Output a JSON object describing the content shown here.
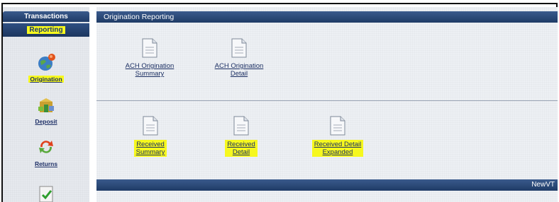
{
  "sidebar": {
    "tabs": [
      "Transactions",
      "Reporting"
    ],
    "items": [
      {
        "label": "Origination"
      },
      {
        "label": "Deposit"
      },
      {
        "label": "Returns"
      }
    ]
  },
  "main": {
    "title": "Origination Reporting",
    "section1": [
      {
        "line1": "ACH Origination",
        "line2": "Summary"
      },
      {
        "line1": "ACH Origination",
        "line2": "Detail"
      }
    ],
    "section2": [
      {
        "line1": "Received",
        "line2": "Summary"
      },
      {
        "line1": "Received",
        "line2": "Detail"
      },
      {
        "line1": "Received Detail",
        "line2": "Expanded"
      }
    ],
    "footer_text": "NewVT"
  },
  "colors": {
    "header_blue": "#1f3b66",
    "highlight": "#f6f81e",
    "link": "#1c2f63",
    "panel_bg": "#edf0f4"
  }
}
